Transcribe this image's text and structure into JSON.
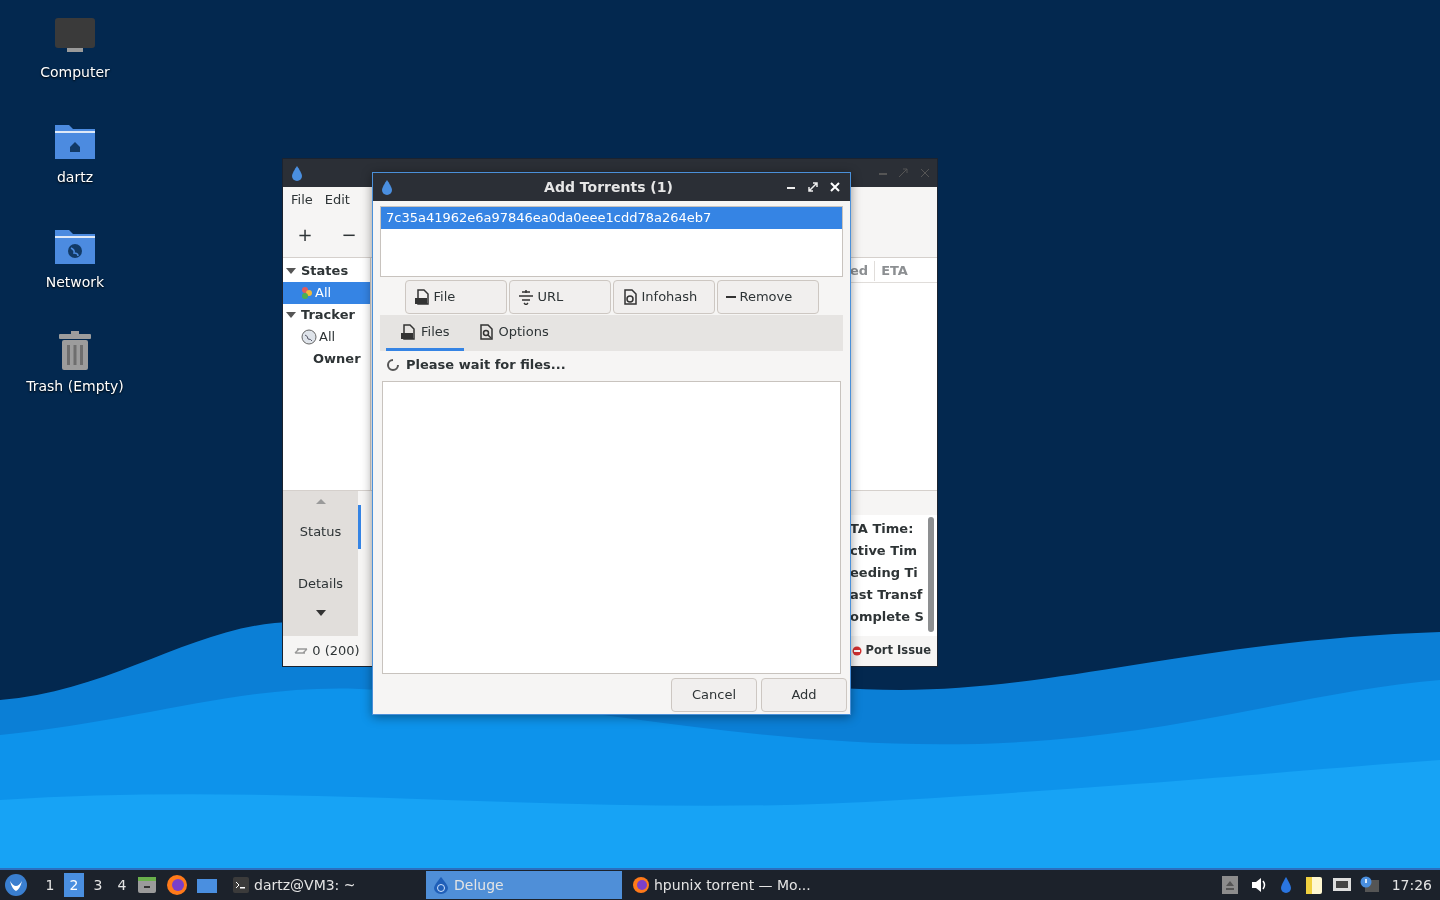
{
  "desktop_icons": [
    {
      "label": "Computer",
      "kind": "computer"
    },
    {
      "label": "dartz",
      "kind": "home"
    },
    {
      "label": "Network",
      "kind": "network"
    },
    {
      "label": "Trash (Empty)",
      "kind": "trash"
    }
  ],
  "main_window": {
    "menu": [
      "File",
      "Edit"
    ],
    "toolbar": [
      "+",
      "−"
    ],
    "sidebar": [
      {
        "label": "States",
        "expanded": true,
        "children": [
          {
            "label": "All",
            "selected": true,
            "kind": "states"
          }
        ]
      },
      {
        "label": "Tracker",
        "expanded": true,
        "children": [
          {
            "label": "All",
            "selected": false,
            "kind": "tracker"
          }
        ]
      },
      {
        "label": "Owner"
      }
    ],
    "columns": [
      "ed",
      "ETA"
    ],
    "bottom_tabs": [
      {
        "label": "Status",
        "selected": true
      },
      {
        "label": "Details",
        "selected": false
      }
    ],
    "details_labels": [
      "TA Time:",
      "ctive Tim",
      "eeding Ti",
      "ast Transf",
      "omplete S"
    ],
    "status_bar": {
      "connections": "0 (200)",
      "port_status": "Port Issue"
    }
  },
  "dialog": {
    "title": "Add Torrents (1)",
    "torrents": [
      {
        "name": "7c35a41962e6a97846ea0da0eee1cdd78a264eb7",
        "selected": true
      }
    ],
    "buttons": [
      {
        "label": "File",
        "kind": "file"
      },
      {
        "label": "URL",
        "kind": "url"
      },
      {
        "label": "Infohash",
        "kind": "infohash"
      },
      {
        "label": "Remove",
        "kind": "remove"
      }
    ],
    "tabs": [
      {
        "label": "Files",
        "selected": true,
        "kind": "files"
      },
      {
        "label": "Options",
        "selected": false,
        "kind": "options"
      }
    ],
    "status": "Please wait for files...",
    "actions": [
      "Cancel",
      "Add"
    ]
  },
  "taskbar": {
    "workspaces": [
      {
        "label": "1",
        "selected": false
      },
      {
        "label": "2",
        "selected": true
      },
      {
        "label": "3",
        "selected": false
      },
      {
        "label": "4",
        "selected": false
      }
    ],
    "tasks": [
      {
        "label": "dartz@VM3: ~",
        "active": false,
        "kind": "terminal"
      },
      {
        "label": "Deluge",
        "active": true,
        "kind": "deluge"
      },
      {
        "label": "hpunix torrent — Mo...",
        "active": false,
        "kind": "browser"
      }
    ],
    "clock": "17:26"
  }
}
